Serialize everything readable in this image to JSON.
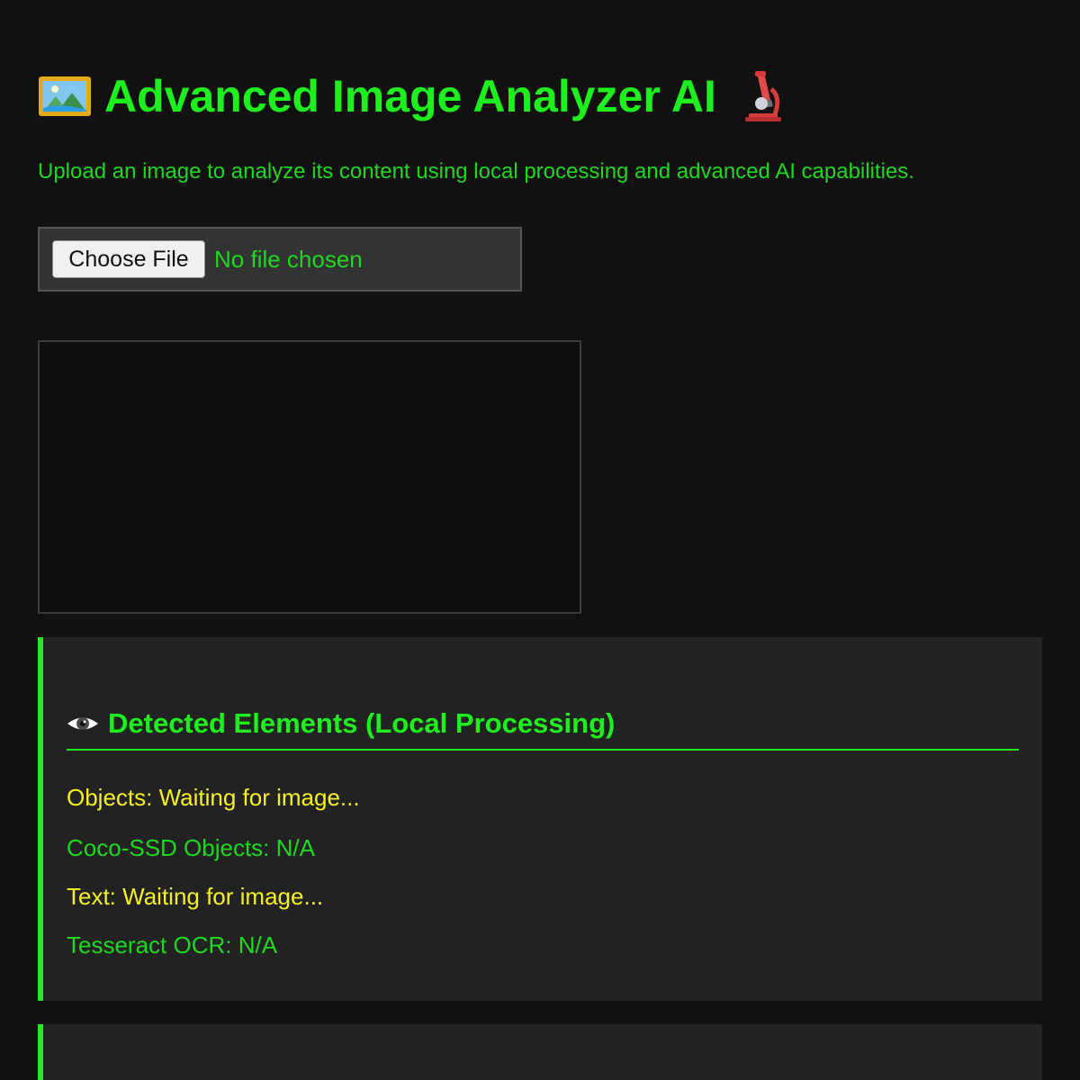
{
  "header": {
    "title": "Advanced Image Analyzer AI",
    "title_icon_left": "framed-picture-icon",
    "title_icon_right": "microscope-icon",
    "subtitle": "Upload an image to analyze its content using local processing and advanced AI capabilities."
  },
  "file_input": {
    "button_label": "Choose File",
    "status": "No file chosen"
  },
  "detected_panel": {
    "icon": "eye-icon",
    "heading": "Detected Elements (Local Processing)",
    "objects": "Objects: Waiting for image...",
    "coco_ssd": "Coco-SSD Objects: N/A",
    "text": "Text: Waiting for image...",
    "tesseract": "Tesseract OCR: N/A"
  },
  "colors": {
    "background": "#111111",
    "accent_green": "#1ef01e",
    "text_green": "#1ed81e",
    "warning_yellow": "#f4f024",
    "panel_background": "#222222"
  }
}
